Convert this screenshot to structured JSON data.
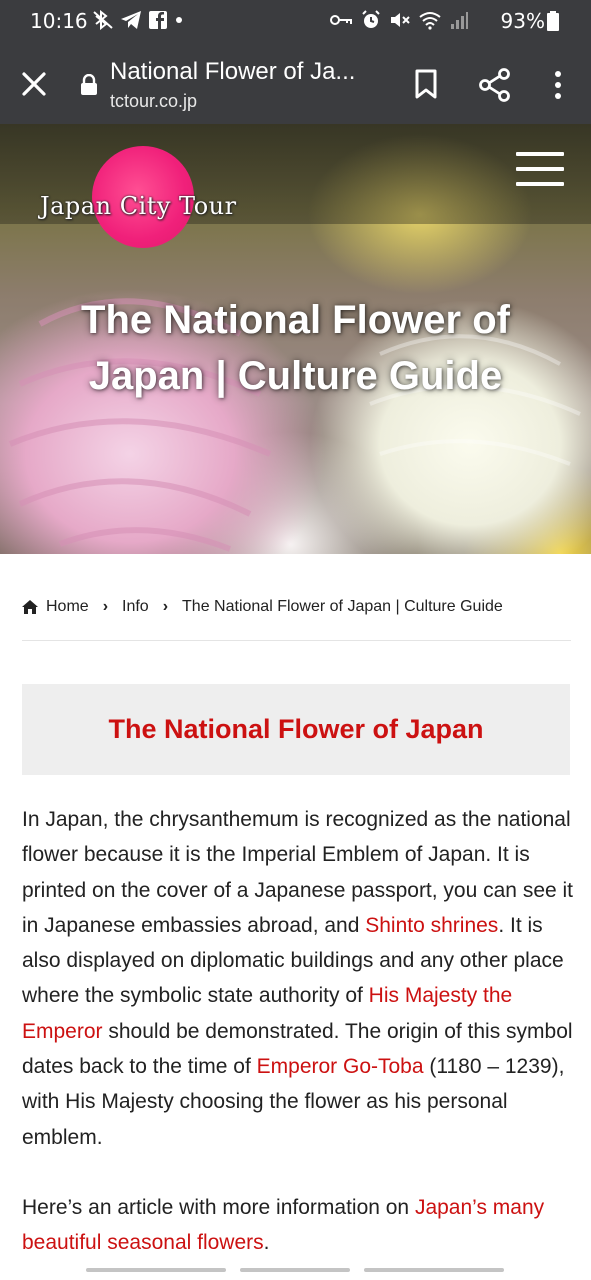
{
  "status_bar": {
    "time": "10:16",
    "battery_percent": "93%",
    "left_icons": [
      "bluetooth-off-icon",
      "telegram-icon",
      "facebook-icon",
      "dot-icon"
    ],
    "right_icons": [
      "vpn-key-icon",
      "alarm-icon",
      "mute-icon",
      "wifi-icon",
      "signal-icon",
      "battery-icon"
    ]
  },
  "browser": {
    "page_title": "National Flower of Ja...",
    "url": "tctour.co.jp",
    "icons": [
      "close-icon",
      "lock-icon",
      "bookmark-icon",
      "share-icon",
      "more-vert-icon"
    ]
  },
  "hero": {
    "logo_text": "Japan City Tour",
    "title": "The National Flower of Japan | Culture Guide",
    "menu_icon": "hamburger-menu-icon"
  },
  "breadcrumb": {
    "home": "Home",
    "info": "Info",
    "current": "The National Flower of Japan | Culture Guide",
    "separator": "›"
  },
  "section": {
    "heading": "The National Flower of Japan"
  },
  "article": {
    "p1_a": "In Japan, the chrysanthemum is recognized as the national flower because it is the Imperial Emblem of Japan. It is printed on the cover of a Japanese passport, you can see it in Japanese embassies abroad, and ",
    "link_shinto": "Shinto shrines",
    "p1_b": ". It is also displayed on diplomatic buildings and any other place where the symbolic state authority of ",
    "link_emperor": "His Majesty the Emperor",
    "p1_c": " should be demonstrated. The origin of this symbol dates back to the time of ",
    "link_gotoba": "Emperor Go-Toba",
    "p1_d": " (1180 – 1239), with His Majesty choosing the flower as his personal emblem.",
    "p2_a": "Here’s an article with more information on ",
    "link_seasonal": "Japan’s many beautiful seasonal flowers",
    "p2_b": "."
  },
  "colors": {
    "bar_background": "#3b3c3f",
    "accent_red": "#cc1111",
    "heading_box": "#eeeeee",
    "logo_pink": "#f0207a"
  }
}
